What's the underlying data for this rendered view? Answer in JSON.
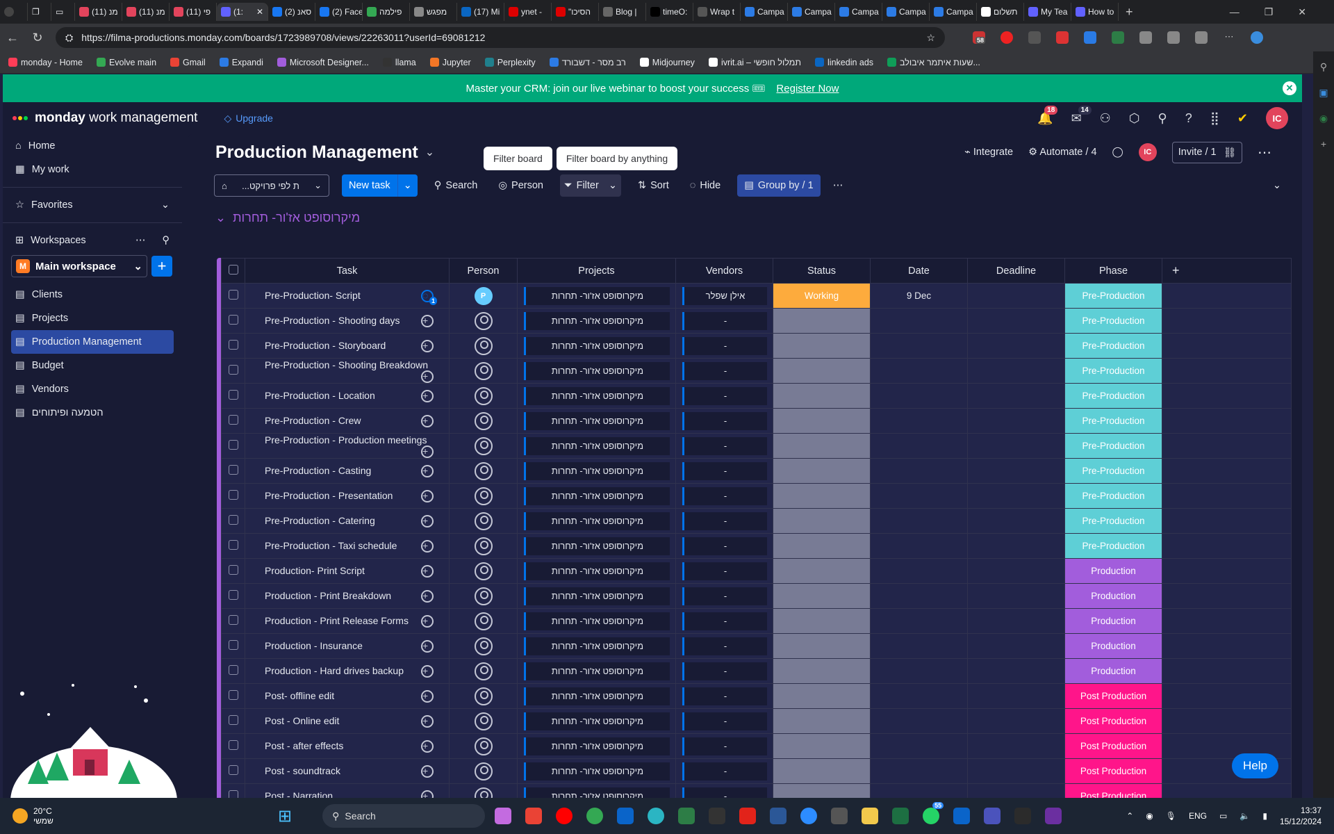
{
  "browser": {
    "tabs": [
      {
        "label": "(11) מנ",
        "color": "#e2445c"
      },
      {
        "label": "(11) מנ",
        "color": "#e2445c"
      },
      {
        "label": "(11) פי",
        "color": "#e2445c"
      },
      {
        "label": "(1:",
        "color": "#6161ff",
        "active": true
      },
      {
        "label": "סאנ (2)",
        "color": "#1877f2"
      },
      {
        "label": "(2) Face",
        "color": "#1877f2"
      },
      {
        "label": "פילמה",
        "color": "#34a853"
      },
      {
        "label": "מפגש",
        "color": "#888"
      },
      {
        "label": "(17) Mi",
        "color": "#0a66c2"
      },
      {
        "label": "ynet -",
        "color": "#d00"
      },
      {
        "label": "\"הסיכו",
        "color": "#d00"
      },
      {
        "label": "Blog |",
        "color": "#666"
      },
      {
        "label": "timeO:",
        "color": "#000"
      },
      {
        "label": "Wrap t",
        "color": "#555"
      },
      {
        "label": "Campa",
        "color": "#2c7be5"
      },
      {
        "label": "Campa",
        "color": "#2c7be5"
      },
      {
        "label": "Campa",
        "color": "#2c7be5"
      },
      {
        "label": "Campa",
        "color": "#2c7be5"
      },
      {
        "label": "Campa",
        "color": "#2c7be5"
      },
      {
        "label": "תשלום",
        "color": "#fff"
      },
      {
        "label": "My Tea",
        "color": "#6161ff"
      },
      {
        "label": "How to",
        "color": "#6161ff"
      }
    ],
    "url": "https://filma-productions.monday.com/boards/1723989708/views/22263011?userId=69081212",
    "bookmarks": [
      {
        "label": "monday - Home",
        "color": "#ff3d57"
      },
      {
        "label": "Evolve main",
        "color": "#34a853"
      },
      {
        "label": "Gmail",
        "color": "#ea4335"
      },
      {
        "label": "Expandi",
        "color": "#2c7be5"
      },
      {
        "label": "Microsoft Designer...",
        "color": "#a25ddc"
      },
      {
        "label": "llama",
        "color": "#333"
      },
      {
        "label": "Jupyter",
        "color": "#f37626"
      },
      {
        "label": "Perplexity",
        "color": "#20808d"
      },
      {
        "label": "רב מסר - דשבורד",
        "color": "#2c7be5"
      },
      {
        "label": "Midjourney",
        "color": "#fff"
      },
      {
        "label": "ivrit.ai – תמלול חופשי",
        "color": "#fff"
      },
      {
        "label": "linkedin ads",
        "color": "#0a66c2"
      },
      {
        "label": "שעות איתמר איבולב...",
        "color": "#0f9d58"
      }
    ],
    "extension_badge": "58"
  },
  "banner": {
    "text": "Master your CRM: join our live webinar to boost your success 🎟",
    "link": "Register Now"
  },
  "topnav": {
    "brand_bold": "monday",
    "brand_rest": " work management",
    "upgrade": "Upgrade",
    "notifications_count": "18",
    "inbox_count": "14",
    "avatar_initials": "IC"
  },
  "sidebar": {
    "home": "Home",
    "my_work": "My work",
    "favorites": "Favorites",
    "workspaces": "Workspaces",
    "workspace_name": "Main workspace",
    "workspace_letter": "M",
    "boards": [
      "Clients",
      "Projects",
      "Production Management",
      "Budget",
      "Vendors",
      "הטמעה ופיתוחים"
    ]
  },
  "board": {
    "title": "Production Management",
    "tooltip_left": "Filter board",
    "tooltip_right": "Filter board by anything",
    "integrate": "Integrate",
    "automate": "Automate / 4",
    "invite": "Invite / 1",
    "view_select": "...ת לפי פרויקט",
    "new_task": "New task",
    "search": "Search",
    "person": "Person",
    "filter": "Filter",
    "sort": "Sort",
    "hide": "Hide",
    "group_by": "Group by / 1",
    "group_title": "מיקרוסופט אז'ור- תחרות",
    "columns": [
      "Task",
      "Person",
      "Projects",
      "Vendors",
      "Status",
      "Date",
      "Deadline",
      "Phase"
    ],
    "rows": [
      {
        "task": "Pre-Production- Script",
        "project": "מיקרוסופט אז'ור- תחרות",
        "vendor": "אילן שפלר",
        "status": "Working",
        "date": "9 Dec",
        "phase": "Pre-Production",
        "person": "P",
        "updates": "1"
      },
      {
        "task": "Pre-Production - Shooting days",
        "project": "מיקרוסופט אז'ור- תחרות",
        "vendor": "-",
        "status": "",
        "date": "",
        "phase": "Pre-Production"
      },
      {
        "task": "Pre-Production - Storyboard",
        "project": "מיקרוסופט אז'ור- תחרות",
        "vendor": "-",
        "status": "",
        "date": "",
        "phase": "Pre-Production"
      },
      {
        "task": "Pre-Production - Shooting Breakdown",
        "project": "מיקרוסופט אז'ור- תחרות",
        "vendor": "-",
        "status": "",
        "date": "",
        "phase": "Pre-Production"
      },
      {
        "task": "Pre-Production - Location",
        "project": "מיקרוסופט אז'ור- תחרות",
        "vendor": "-",
        "status": "",
        "date": "",
        "phase": "Pre-Production"
      },
      {
        "task": "Pre-Production - Crew",
        "project": "מיקרוסופט אז'ור- תחרות",
        "vendor": "-",
        "status": "",
        "date": "",
        "phase": "Pre-Production"
      },
      {
        "task": "Pre-Production - Production meetings",
        "project": "מיקרוסופט אז'ור- תחרות",
        "vendor": "-",
        "status": "",
        "date": "",
        "phase": "Pre-Production"
      },
      {
        "task": "Pre-Production - Casting",
        "project": "מיקרוסופט אז'ור- תחרות",
        "vendor": "-",
        "status": "",
        "date": "",
        "phase": "Pre-Production"
      },
      {
        "task": "Pre-Production - Presentation",
        "project": "מיקרוסופט אז'ור- תחרות",
        "vendor": "-",
        "status": "",
        "date": "",
        "phase": "Pre-Production"
      },
      {
        "task": "Pre-Production - Catering",
        "project": "מיקרוסופט אז'ור- תחרות",
        "vendor": "-",
        "status": "",
        "date": "",
        "phase": "Pre-Production"
      },
      {
        "task": "Pre-Production - Taxi schedule",
        "project": "מיקרוסופט אז'ור- תחרות",
        "vendor": "-",
        "status": "",
        "date": "",
        "phase": "Pre-Production"
      },
      {
        "task": "Production- Print Script",
        "project": "מיקרוסופט אז'ור- תחרות",
        "vendor": "-",
        "status": "",
        "date": "",
        "phase": "Production"
      },
      {
        "task": "Production - Print Breakdown",
        "project": "מיקרוסופט אז'ור- תחרות",
        "vendor": "-",
        "status": "",
        "date": "",
        "phase": "Production"
      },
      {
        "task": "Production - Print Release Forms",
        "project": "מיקרוסופט אז'ור- תחרות",
        "vendor": "-",
        "status": "",
        "date": "",
        "phase": "Production"
      },
      {
        "task": "Production - Insurance",
        "project": "מיקרוסופט אז'ור- תחרות",
        "vendor": "-",
        "status": "",
        "date": "",
        "phase": "Production"
      },
      {
        "task": "Production - Hard drives backup",
        "project": "מיקרוסופט אז'ור- תחרות",
        "vendor": "-",
        "status": "",
        "date": "",
        "phase": "Production"
      },
      {
        "task": "Post- offline edit",
        "project": "מיקרוסופט אז'ור- תחרות",
        "vendor": "-",
        "status": "",
        "date": "",
        "phase": "Post Production"
      },
      {
        "task": "Post - Online edit",
        "project": "מיקרוסופט אז'ור- תחרות",
        "vendor": "-",
        "status": "",
        "date": "",
        "phase": "Post Production"
      },
      {
        "task": "Post - after effects",
        "project": "מיקרוסופט אז'ור- תחרות",
        "vendor": "-",
        "status": "",
        "date": "",
        "phase": "Post Production"
      },
      {
        "task": "Post - soundtrack",
        "project": "מיקרוסופט אז'ור- תחרות",
        "vendor": "-",
        "status": "",
        "date": "",
        "phase": "Post Production"
      },
      {
        "task": "Post - Narration",
        "project": "מיקרוסופט אז'ור- תחרות",
        "vendor": "-",
        "status": "",
        "date": "",
        "phase": "Post Production"
      }
    ],
    "help": "Help"
  },
  "taskbar": {
    "temp": "20°C",
    "weather": "שמשי",
    "search": "Search",
    "lang": "ENG",
    "time": "13:37",
    "date": "15/12/2024",
    "whatsapp_badge": "55"
  },
  "colors": {
    "working": "#fdab3d",
    "pre_production": "#5ecfd6",
    "production": "#a25ddc",
    "post_production": "#ff158a",
    "accent": "#0073ea"
  }
}
